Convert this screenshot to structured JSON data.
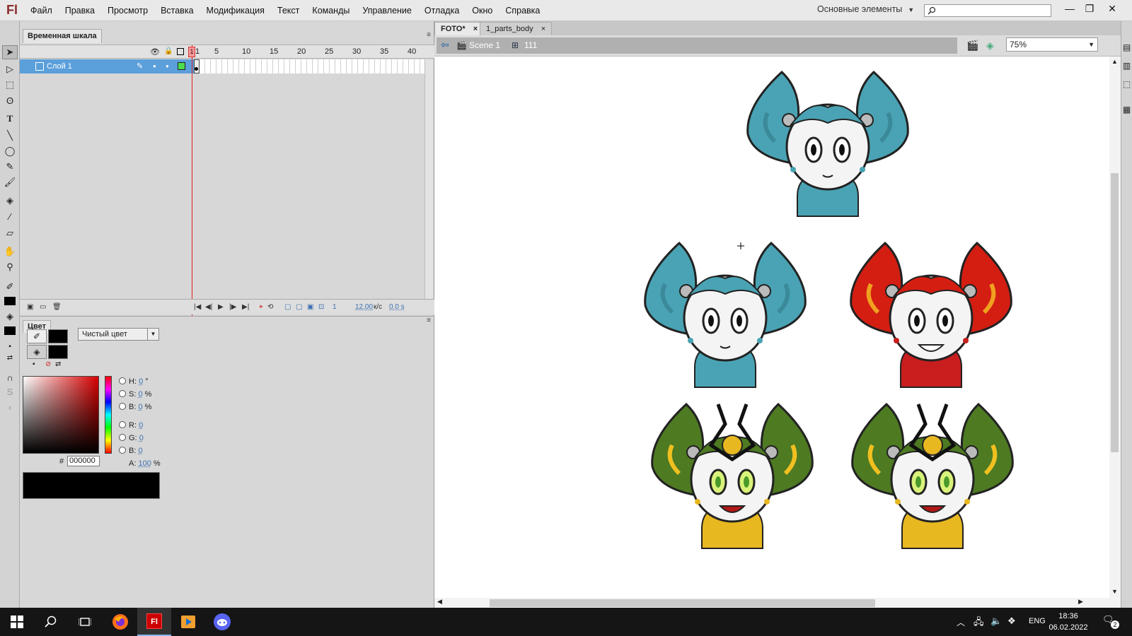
{
  "app": {
    "logo": "Fl"
  },
  "menu": [
    "Файл",
    "Правка",
    "Просмотр",
    "Вставка",
    "Модификация",
    "Текст",
    "Команды",
    "Управление",
    "Отладка",
    "Окно",
    "Справка"
  ],
  "workspace": {
    "label": "Основные элементы"
  },
  "search": {
    "placeholder": ""
  },
  "timeline": {
    "tab": "Временная шкала",
    "ruler": [
      "1",
      "5",
      "10",
      "15",
      "20",
      "25",
      "30",
      "35",
      "40"
    ],
    "layer": "Слой 1",
    "status": {
      "frame": "1",
      "fps": "12.00",
      "fps_unit": "к/с",
      "time": "0.0 s"
    }
  },
  "color": {
    "tab": "Цвет",
    "type": "Чистый цвет",
    "fields": [
      {
        "label": "H:",
        "value": "0",
        "unit": "°"
      },
      {
        "label": "S:",
        "value": "0",
        "unit": "%"
      },
      {
        "label": "B:",
        "value": "0",
        "unit": "%"
      },
      {
        "label": "R:",
        "value": "0",
        "unit": ""
      },
      {
        "label": "G:",
        "value": "0",
        "unit": ""
      },
      {
        "label": "B:",
        "value": "0",
        "unit": ""
      }
    ],
    "alpha": {
      "label": "A:",
      "value": "100",
      "unit": "%"
    },
    "hex_label": "#",
    "hex": "000000",
    "stroke_color": "#000000",
    "fill_color": "#000000"
  },
  "doc_tabs": [
    "FOTO*",
    "1_parts_body"
  ],
  "editbar": {
    "scene": "Scene 1",
    "symbol": "111",
    "zoom": "75%"
  },
  "taskbar": {
    "lang": "ENG",
    "time": "18:36",
    "date": "06.02.2022",
    "notifications": "2"
  },
  "stage": {
    "characters": [
      {
        "name": "teal-robot-girl-top",
        "hair": "#4aa3b4",
        "hair_shade": "#3a8a9a",
        "accent": "#4aa3b4"
      },
      {
        "name": "teal-robot-girl-left",
        "hair": "#4aa3b4",
        "hair_shade": "#3a8a9a",
        "accent": "#4aa3b4"
      },
      {
        "name": "red-robot-girl",
        "hair": "#d41e12",
        "hair_shade": "#f0a020",
        "accent": "#c81e1e"
      },
      {
        "name": "green-alien-girl-left",
        "hair": "#4e7a22",
        "hair_shade": "#f0c020",
        "accent": "#e8b820"
      },
      {
        "name": "green-alien-girl-right",
        "hair": "#4e7a22",
        "hair_shade": "#f0c020",
        "accent": "#e8b820"
      }
    ]
  }
}
